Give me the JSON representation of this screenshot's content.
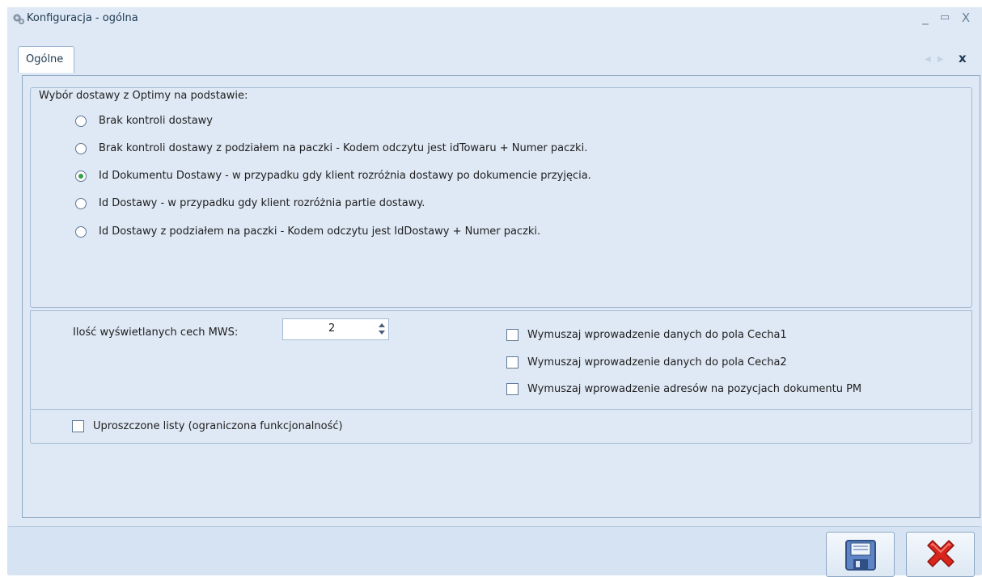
{
  "window": {
    "title": "Konfiguracja - ogólna",
    "minimize_glyph": "_",
    "maximize_glyph": "▭",
    "close_glyph": "X"
  },
  "tabs": {
    "active_label": "Ogólne",
    "nav_left": "◀",
    "nav_right": "▶",
    "close_glyph": "x"
  },
  "delivery_group": {
    "caption": "Wybór dostawy z Optimy na podstawie:",
    "selected_index": 2,
    "options": [
      "Brak kontroli dostawy",
      "Brak kontroli dostawy z podziałem na paczki - Kodem odczytu jest idTowaru + Numer paczki.",
      "Id Dokumentu Dostawy - w przypadku gdy klient rozróżnia dostawy po dokumencie przyjęcia.",
      "Id Dostawy - w przypadku gdy klient rozróżnia partie dostawy.",
      "Id Dostawy z podziałem na paczki - Kodem odczytu jest IdDostawy + Numer paczki."
    ]
  },
  "mws": {
    "label": "Ilość wyświetlanych cech MWS:",
    "value": "2"
  },
  "checks": {
    "cecha1": "Wymuszaj wprowadzenie danych do pola Cecha1",
    "cecha2": "Wymuszaj wprowadzenie danych do pola Cecha2",
    "adresy_pm": "Wymuszaj wprowadzenie adresów na pozycjach dokumentu PM",
    "uproszczone": "Uproszczone listy (ograniczona funkcjonalność)"
  },
  "buttons": {
    "save_icon": "floppy-disk-icon",
    "cancel_icon": "red-x-icon"
  },
  "colors": {
    "background": "#dfe9f5",
    "radio_selected": "#35a048",
    "cancel_red": "#d9261c"
  }
}
